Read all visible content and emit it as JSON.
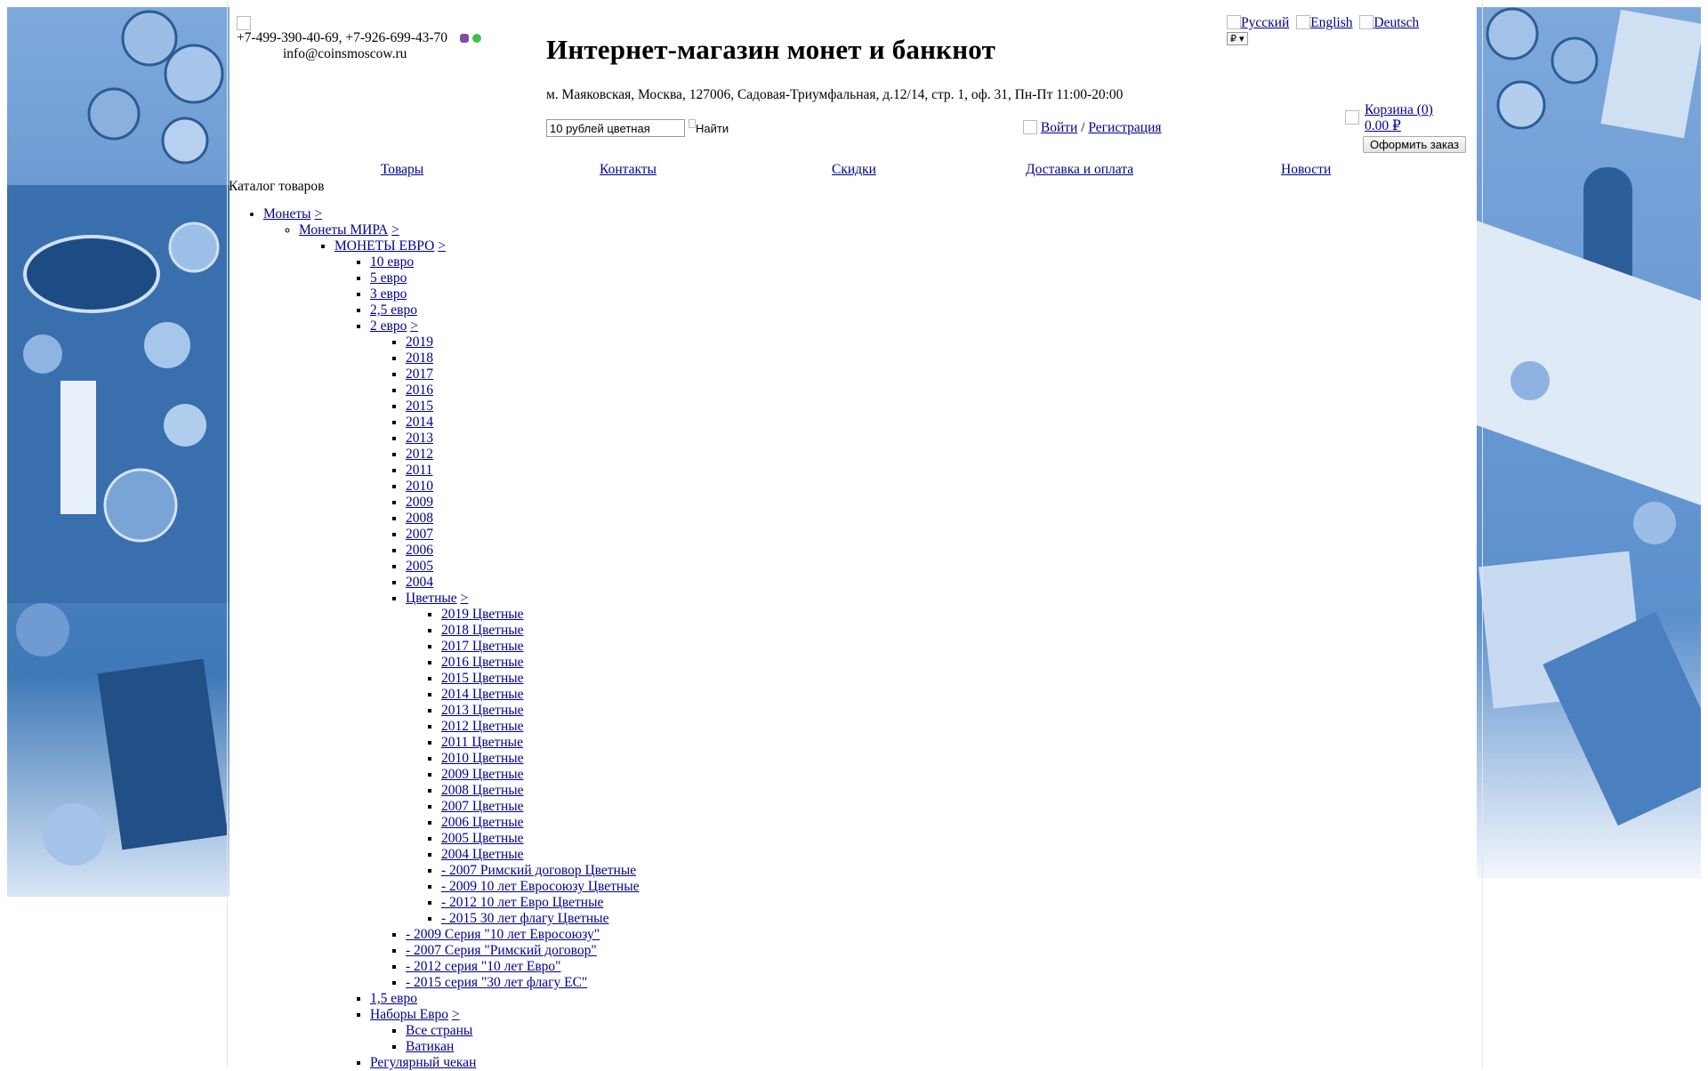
{
  "header": {
    "phones": "+7-499-390-40-69, +7-926-699-43-70",
    "email": "info@coinsmoscow.ru",
    "site_title": "Интернет-магазин монет и банкнот",
    "address": "м. Маяковская, Москва, 127006, Садовая-Триумфальная, д.12/14, стр. 1, оф. 31, Пн-Пт 11:00-20:00",
    "search_value": "10 рублей цветная",
    "search_button": "Найти",
    "login": "Войти",
    "auth_separator": " / ",
    "register": "Регистрация",
    "languages": [
      "Русский",
      "English",
      "Deutsch"
    ],
    "currency": "₽ ▾",
    "cart_label": "Корзина (0)",
    "cart_total": "0.00 ₽",
    "order_button": "Оформить заказ"
  },
  "nav": [
    "Товары",
    "Контакты",
    "Скидки",
    "Доставка и оплата",
    "Новости"
  ],
  "catalog": {
    "title": "Каталог товаров",
    "level1": "Монеты",
    "level2": "Монеты МИРА",
    "level3": "МОНЕТЫ ЕВРО",
    "arrow": ">",
    "euro_items": [
      "10 евро",
      "5 евро",
      "3 евро",
      "2,5 евро",
      "2 евро"
    ],
    "two_euro_years": [
      "2019",
      "2018",
      "2017",
      "2016",
      "2015",
      "2014",
      "2013",
      "2012",
      "2011",
      "2010",
      "2009",
      "2008",
      "2007",
      "2006",
      "2005",
      "2004",
      "Цветные"
    ],
    "colored": [
      "2019 Цветные",
      "2018 Цветные",
      "2017 Цветные",
      "2016 Цветные",
      "2015 Цветные",
      "2014 Цветные",
      "2013 Цветные",
      "2012 Цветные",
      "2011 Цветные",
      "2010 Цветные",
      "2009 Цветные",
      "2008 Цветные",
      "2007 Цветные",
      "2006 Цветные",
      "2005 Цветные",
      "2004 Цветные",
      "- 2007 Римский договор Цветные",
      "- 2009 10 лет Евросоюзу Цветные",
      "- 2012 10 лет Евро Цветные",
      "- 2015 30 лет флагу Цветные"
    ],
    "two_euro_series": [
      "- 2009 Серия \"10 лет Евросоюзу\"",
      "- 2007 Серия \"Римский договор\"",
      "- 2012 серия \"10 лет Евро\"",
      "- 2015 серия \"30 лет флагу ЕС\""
    ],
    "euro_items_after": [
      "1,5 евро",
      "Наборы Евро"
    ],
    "sets": [
      "Все страны",
      "Ватикан"
    ],
    "last_item": "Регулярный чекан"
  },
  "colors": {
    "link": "#00008b",
    "side_art": "#4a84c4"
  }
}
